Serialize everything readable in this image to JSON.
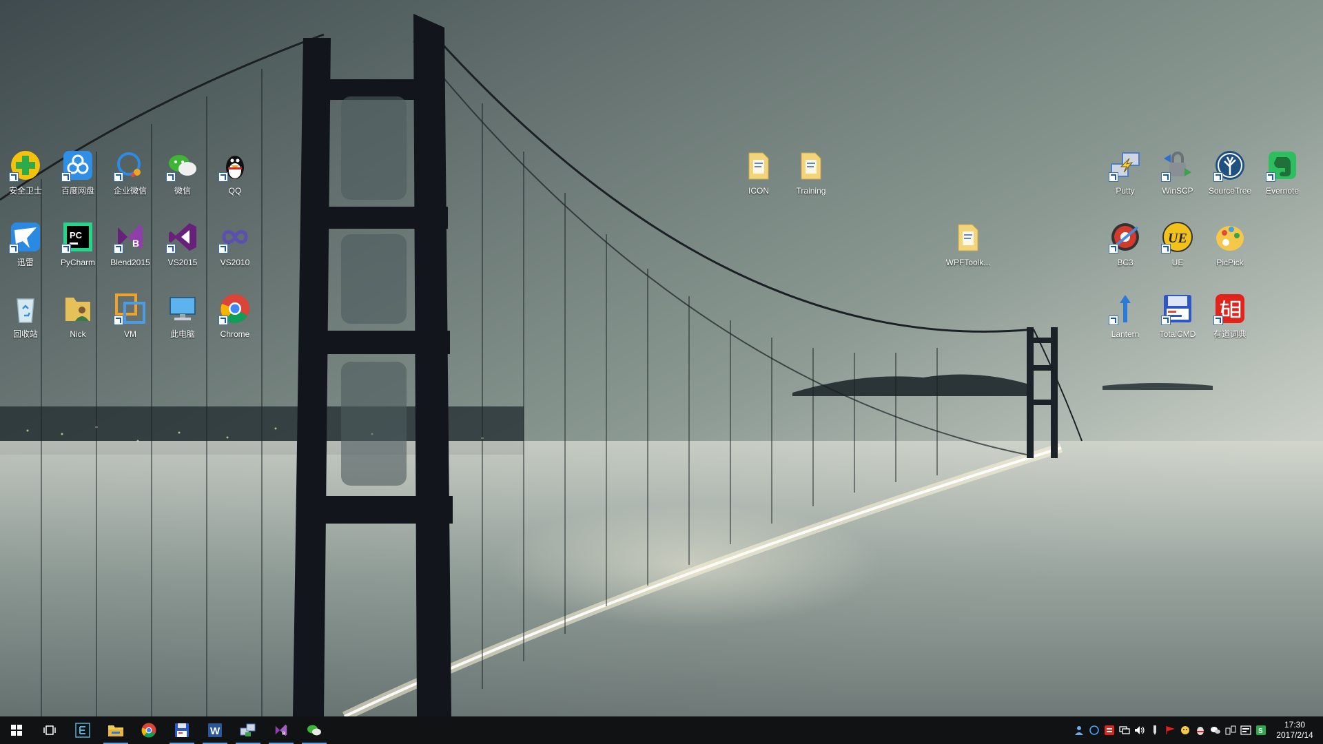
{
  "desktop": {
    "icons": [
      {
        "label": "安全卫士",
        "icon": "360-security-icon",
        "color": "#f4c20d"
      },
      {
        "label": "百度网盘",
        "icon": "baidu-netdisk-icon",
        "color": "#2f8ee5"
      },
      {
        "label": "企业微信",
        "icon": "wework-icon",
        "color": "#2b8be7"
      },
      {
        "label": "微信",
        "icon": "wechat-icon",
        "color": "#3eb535"
      },
      {
        "label": "QQ",
        "icon": "qq-penguin-icon",
        "color": "#111111"
      },
      {
        "label": "迅雷",
        "icon": "thunder-bird-icon",
        "color": "#2a8ae3"
      },
      {
        "label": "PyCharm",
        "icon": "pycharm-icon",
        "color": "#21d789"
      },
      {
        "label": "Blend2015",
        "icon": "blend-icon",
        "color": "#68217a"
      },
      {
        "label": "VS2015",
        "icon": "visual-studio-2015-icon",
        "color": "#68217a"
      },
      {
        "label": "VS2010",
        "icon": "visual-studio-2010-icon",
        "color": "#5b4fb0"
      },
      {
        "label": "回收站",
        "icon": "recycle-bin-icon",
        "color": "#d6e8f0"
      },
      {
        "label": "Nick",
        "icon": "user-folder-icon",
        "color": "#e6c15a"
      },
      {
        "label": "VM",
        "icon": "vmware-icon",
        "color": "#f0a32b"
      },
      {
        "label": "此电脑",
        "icon": "this-pc-icon",
        "color": "#5db3ee"
      },
      {
        "label": "Chrome",
        "icon": "chrome-icon",
        "color": "#db4437"
      },
      {
        "label": "ICON",
        "icon": "folder-icon",
        "color": "#f3d47a"
      },
      {
        "label": "Training",
        "icon": "folder-icon",
        "color": "#f3d47a"
      },
      {
        "label": "WPFToolk...",
        "icon": "folder-icon",
        "color": "#f3d47a"
      },
      {
        "label": "Putty",
        "icon": "putty-icon",
        "color": "#4b7cc6"
      },
      {
        "label": "WinSCP",
        "icon": "winscp-icon",
        "color": "#4b8a3a"
      },
      {
        "label": "SourceTree",
        "icon": "sourcetree-icon",
        "color": "#205081"
      },
      {
        "label": "Evernote",
        "icon": "evernote-icon",
        "color": "#2dbe60"
      },
      {
        "label": "BC3",
        "icon": "beyond-compare-icon",
        "color": "#d23b2b"
      },
      {
        "label": "UE",
        "icon": "ultraedit-icon",
        "color": "#f2c21b"
      },
      {
        "label": "PicPick",
        "icon": "picpick-icon",
        "color": "#f5a623"
      },
      {
        "label": "Lantern",
        "icon": "lantern-icon",
        "color": "#2c7ad6"
      },
      {
        "label": "TotalCMD",
        "icon": "total-commander-icon",
        "color": "#2d56c8"
      },
      {
        "label": "有道词典",
        "icon": "youdao-dict-icon",
        "color": "#e2231a"
      }
    ]
  },
  "taskbar": {
    "buttons": [
      {
        "name": "start-button",
        "icon": "windows-logo-icon",
        "running": false
      },
      {
        "name": "task-view-button",
        "icon": "task-view-icon",
        "running": false
      },
      {
        "name": "edge-button",
        "icon": "e-app-icon",
        "running": false
      },
      {
        "name": "file-explorer-button",
        "icon": "file-explorer-icon",
        "running": true
      },
      {
        "name": "chrome-button",
        "icon": "chrome-icon",
        "running": false
      },
      {
        "name": "save-app-button",
        "icon": "floppy-icon",
        "running": true
      },
      {
        "name": "word-button",
        "icon": "word-icon",
        "running": true
      },
      {
        "name": "network-tool-button",
        "icon": "network-tool-icon",
        "running": true
      },
      {
        "name": "blend-button",
        "icon": "blend-icon",
        "running": true
      },
      {
        "name": "wechat-button",
        "icon": "wechat-icon",
        "running": true
      }
    ],
    "clock": {
      "time": "17:30",
      "date": "2017/2/14"
    }
  }
}
